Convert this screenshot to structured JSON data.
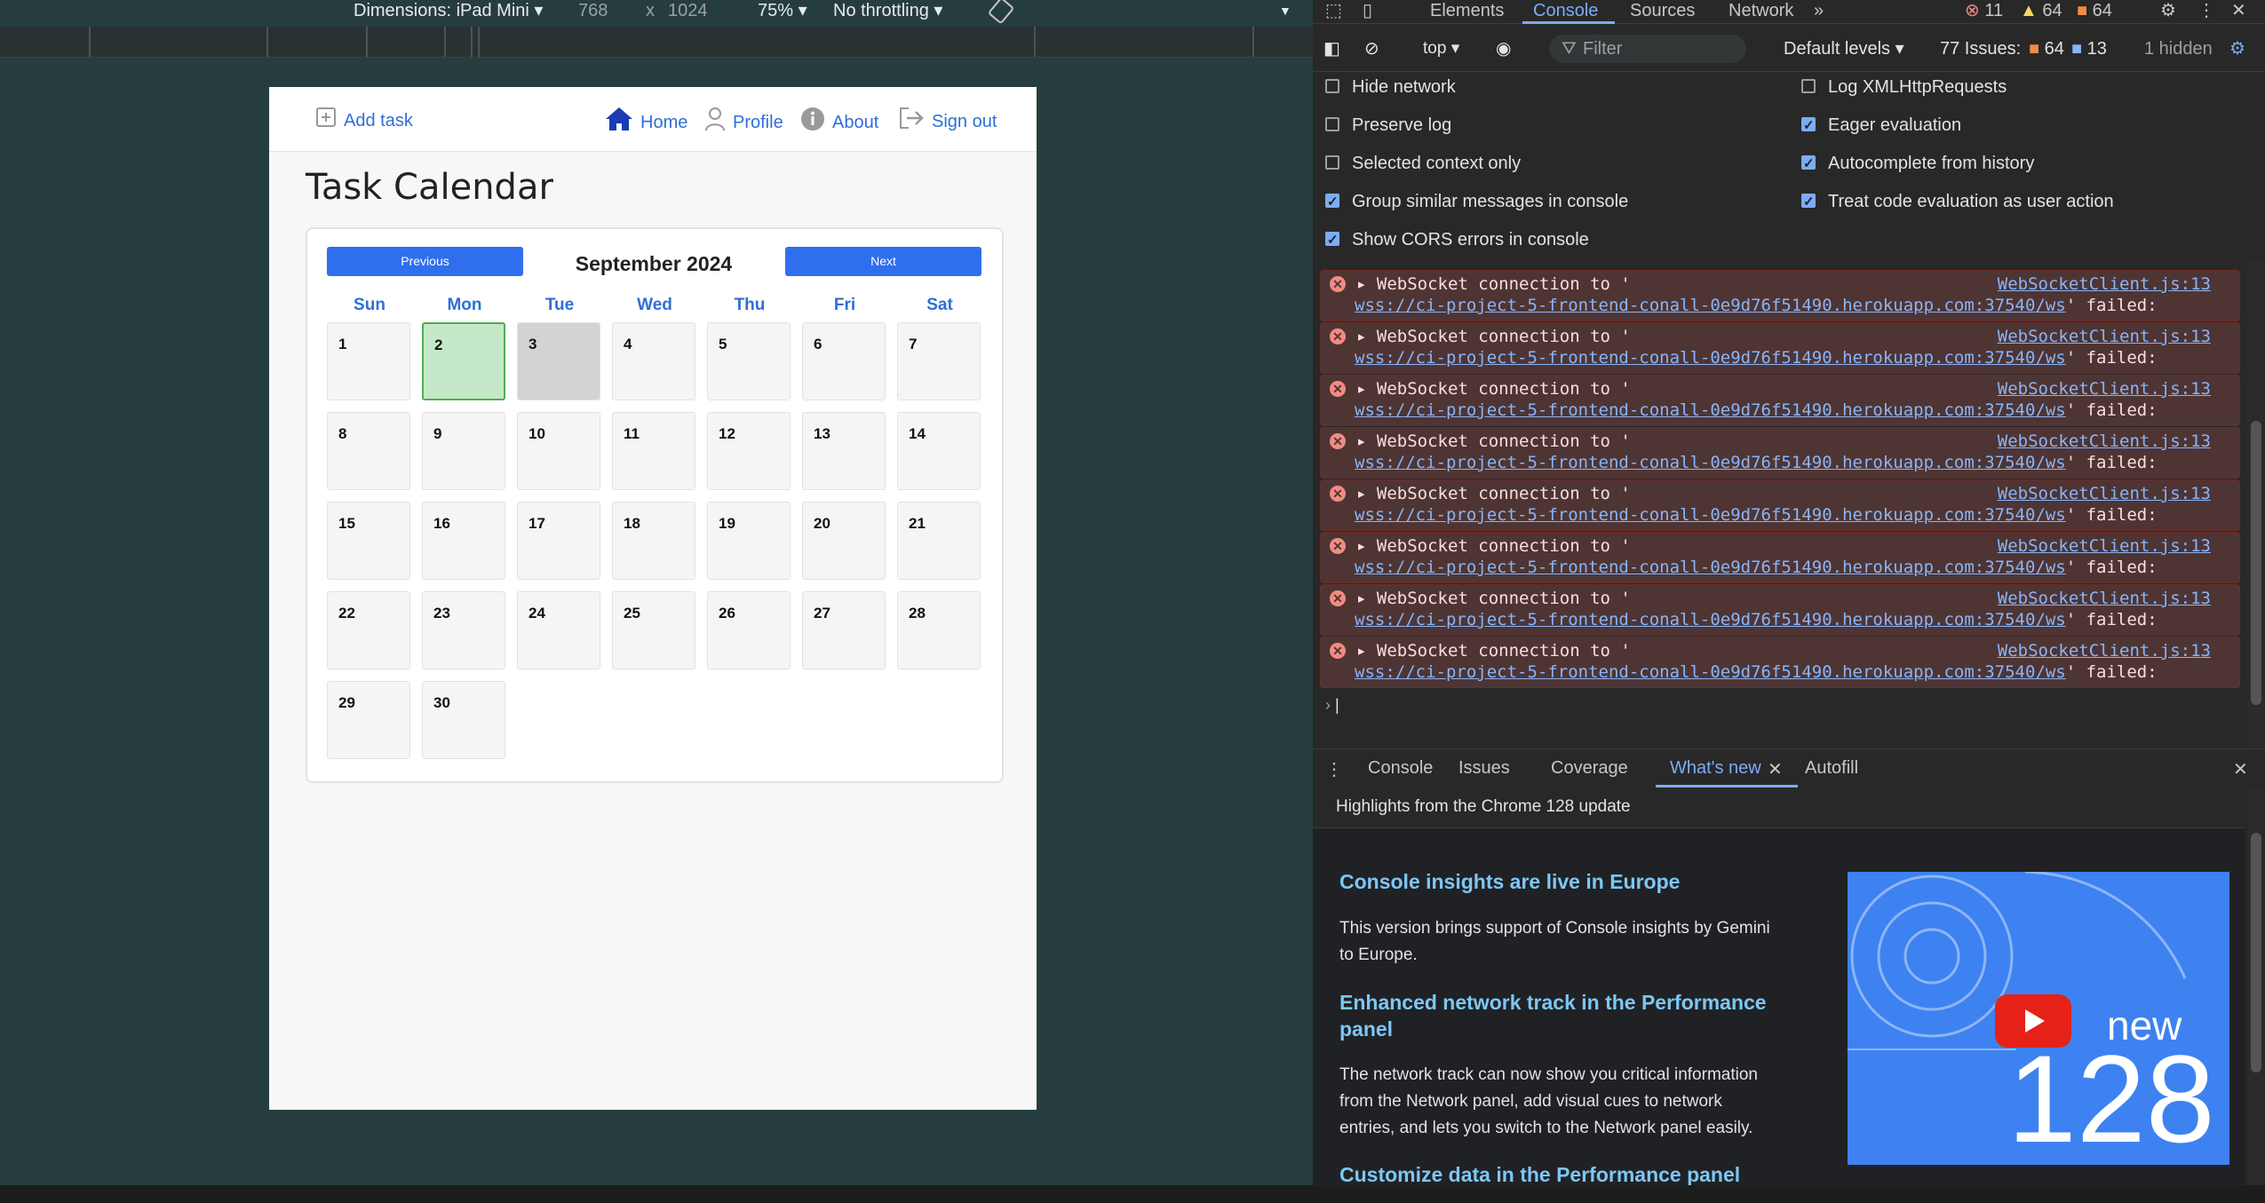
{
  "device_toolbar": {
    "dimensions_label": "Dimensions: iPad Mini ▾",
    "width": "768",
    "times": "x",
    "height": "1024",
    "zoom": "75% ▾",
    "throttling": "No throttling ▾"
  },
  "app": {
    "nav": {
      "add_task": "Add task",
      "home": "Home",
      "profile": "Profile",
      "about": "About",
      "sign_out": "Sign out"
    },
    "title": "Task Calendar",
    "calendar": {
      "prev_label": "Previous",
      "next_label": "Next",
      "month": "September 2024",
      "weekdays": [
        "Sun",
        "Mon",
        "Tue",
        "Wed",
        "Thu",
        "Fri",
        "Sat"
      ],
      "days": [
        "1",
        "2",
        "3",
        "4",
        "5",
        "6",
        "7",
        "8",
        "9",
        "10",
        "11",
        "12",
        "13",
        "14",
        "15",
        "16",
        "17",
        "18",
        "19",
        "20",
        "21",
        "22",
        "23",
        "24",
        "25",
        "26",
        "27",
        "28",
        "29",
        "30"
      ],
      "today": "2",
      "selected": "3"
    }
  },
  "devtools": {
    "tabs": [
      "Elements",
      "Console",
      "Sources",
      "Network"
    ],
    "active_tab": "Console",
    "badge_errors": "11",
    "badge_warnings": "64",
    "badge_info": "64",
    "context": "top ▾",
    "filter_placeholder": "Filter",
    "levels": "Default levels ▾",
    "issues_label": "77 Issues:",
    "issues_warn": "64",
    "issues_info": "13",
    "hidden": "1 hidden",
    "settings_left": [
      {
        "label": "Hide network",
        "checked": false
      },
      {
        "label": "Preserve log",
        "checked": false
      },
      {
        "label": "Selected context only",
        "checked": false
      },
      {
        "label": "Group similar messages in console",
        "checked": true
      },
      {
        "label": "Show CORS errors in console",
        "checked": true
      }
    ],
    "settings_right": [
      {
        "label": "Log XMLHttpRequests",
        "checked": false
      },
      {
        "label": "Eager evaluation",
        "checked": true
      },
      {
        "label": "Autocomplete from history",
        "checked": true
      },
      {
        "label": "Treat code evaluation as user action",
        "checked": true
      }
    ],
    "error_line1": "WebSocket connection to '",
    "error_url": "wss://ci-project-5-frontend-conall-0e9d76f51490.herokuapp.com:37540/ws",
    "error_tail": "' failed:",
    "error_source": "WebSocketClient.js:13",
    "drawer_tabs": [
      "Console",
      "Issues",
      "Coverage",
      "What's new",
      "Autofill"
    ],
    "drawer_active": "What's new",
    "whats_new": {
      "header": "Highlights from the Chrome 128 update",
      "h1": "Console insights are live in Europe",
      "p1a": "This version brings support of Console insights by Gemini",
      "p1b": "to Europe.",
      "h2a": "Enhanced network track in the Performance",
      "h2b": "panel",
      "p2a": "The network track can now show you critical information",
      "p2b": "from the Network panel, add visual cues to network",
      "p2c": "entries, and lets you switch to the Network panel easily.",
      "h3": "Customize data in the Performance panel",
      "img_new": "new",
      "img_version": "128"
    }
  }
}
